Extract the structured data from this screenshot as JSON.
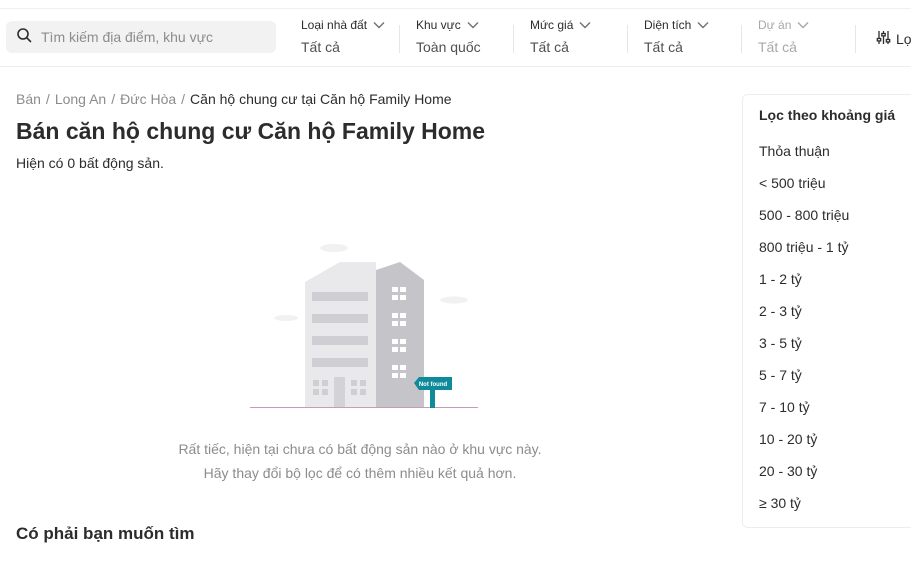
{
  "search": {
    "placeholder": "Tìm kiếm địa điểm, khu vực"
  },
  "filters": [
    {
      "label": "Loại nhà đất",
      "value": "Tất cả"
    },
    {
      "label": "Khu vực",
      "value": "Toàn quốc"
    },
    {
      "label": "Mức giá",
      "value": "Tất cả"
    },
    {
      "label": "Diện tích",
      "value": "Tất cả"
    },
    {
      "label": "Dự án",
      "value": "Tất cả",
      "disabled": true
    }
  ],
  "filter_button": {
    "label": "Lọc"
  },
  "breadcrumb": [
    "Bán",
    "Long An",
    "Đức Hòa",
    "Căn hộ chung cư tại Căn hộ Family Home"
  ],
  "page_title": "Bán căn hộ chung cư Căn hộ Family Home",
  "result_count": "Hiện có 0 bất động sản.",
  "empty_state": {
    "badge": "Not found",
    "line1": "Rất tiếc, hiện tại chưa có bất động sản nào ở khu vực này.",
    "line2": "Hãy thay đổi bộ lọc để có thêm nhiều kết quả hơn."
  },
  "suggest_heading": "Có phải bạn muốn tìm",
  "price_panel": {
    "title": "Lọc theo khoảng giá",
    "items": [
      "Thỏa thuận",
      "< 500 triệu",
      "500 - 800 triệu",
      "800 triệu - 1 tỷ",
      "1 - 2 tỷ",
      "2 - 3 tỷ",
      "3 - 5 tỷ",
      "5 - 7 tỷ",
      "7 - 10 tỷ",
      "10 - 20 tỷ",
      "20 - 30 tỷ",
      "≥ 30 tỷ"
    ]
  },
  "colors": {
    "accent_teal": "#0e8a9a",
    "text": "#2c2c2c",
    "muted": "#8c8c8c"
  }
}
